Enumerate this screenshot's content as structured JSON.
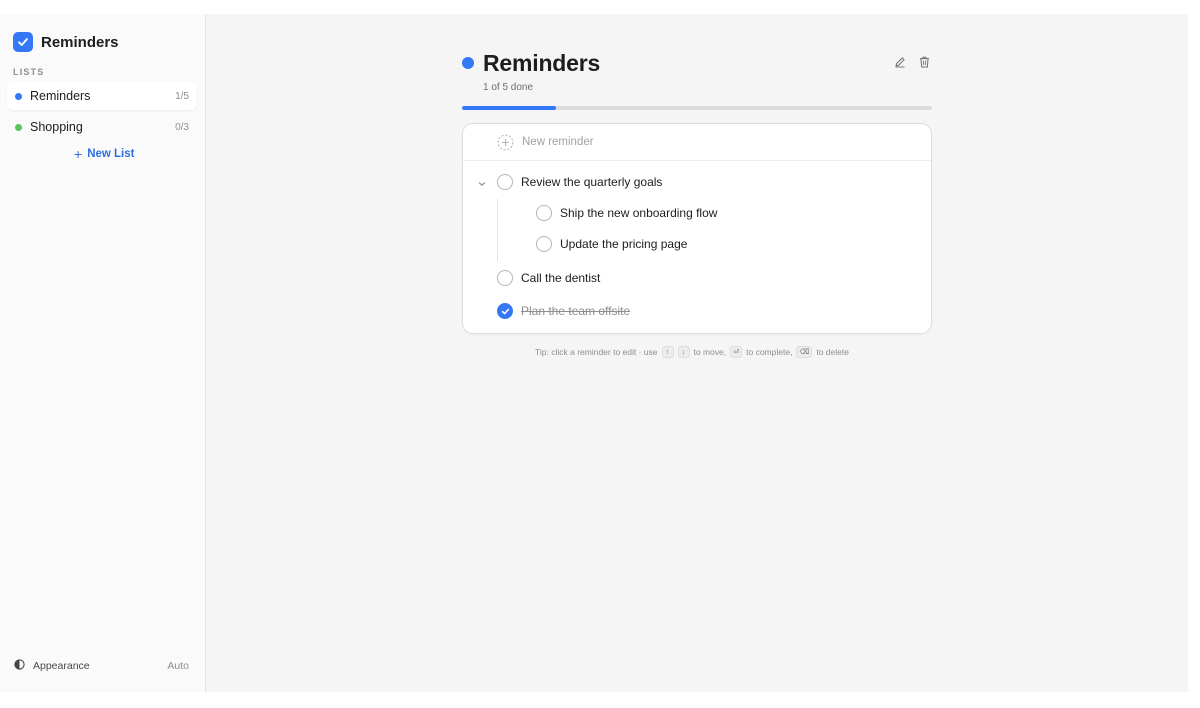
{
  "app": {
    "title": "Reminders"
  },
  "sidebar": {
    "section_label": "LISTS",
    "lists": [
      {
        "name": "Reminders",
        "count": "1/5",
        "color": "#3478f6",
        "active": true
      },
      {
        "name": "Shopping",
        "count": "0/3",
        "color": "#5ac35a",
        "active": false
      }
    ],
    "new_list_label": "New List",
    "appearance": {
      "label": "Appearance",
      "value": "Auto"
    }
  },
  "header": {
    "title": "Reminders",
    "dot_color": "#3478f6",
    "progress_text": "1 of 5 done",
    "progress_fraction": 0.2,
    "tools": [
      "pencil-icon",
      "trash-icon"
    ]
  },
  "composer": {
    "placeholder": "New reminder"
  },
  "reminders": [
    {
      "text": "Review the quarterly goals",
      "done": false,
      "expanded": true,
      "subtasks": [
        {
          "text": "Ship the new onboarding flow",
          "done": false
        },
        {
          "text": "Update the pricing page",
          "done": false
        }
      ]
    },
    {
      "text": "Call the dentist",
      "done": false
    },
    {
      "text": "Plan the team offsite",
      "done": true
    }
  ],
  "tip": {
    "prefix": "Tip: click a reminder to edit · use",
    "key_up": "↑",
    "key_down": "↓",
    "move": "to move,",
    "key_enter": "⏎",
    "complete": "to complete,",
    "key_delete": "⌫",
    "delete": "to delete"
  }
}
